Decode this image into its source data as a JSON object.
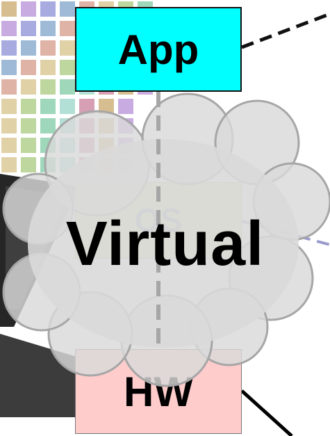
{
  "diagram": {
    "layers": {
      "app": {
        "label": "App",
        "color": "#00ffff"
      },
      "os": {
        "label": "OS",
        "color": "#e6e6a8"
      },
      "hw": {
        "label": "HW",
        "color": "#ffcccc"
      }
    },
    "overlay_label": "Virtual",
    "cloud_color": "#d9d9d9"
  }
}
